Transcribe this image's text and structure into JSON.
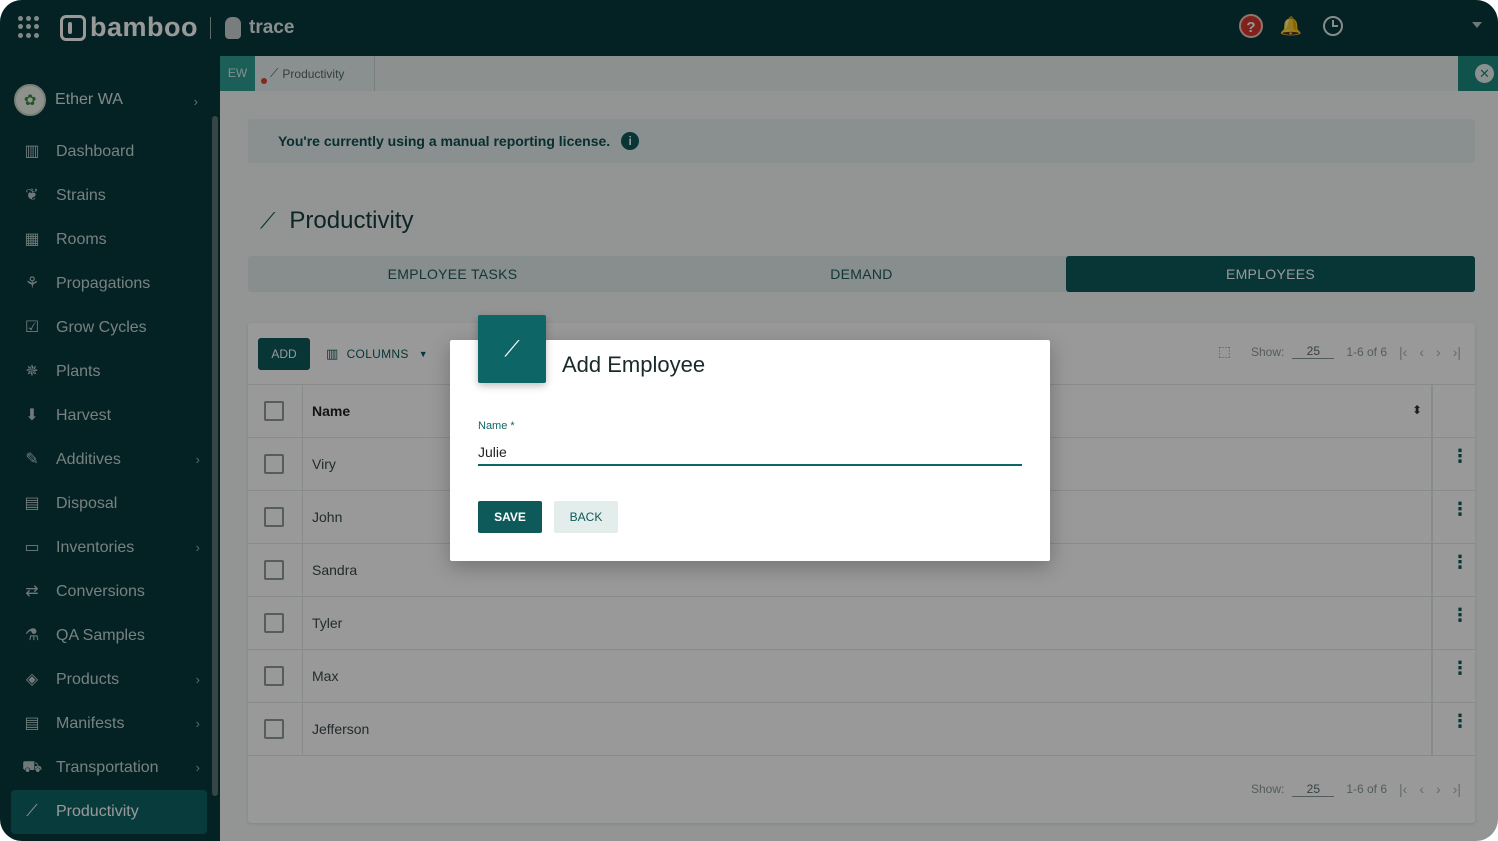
{
  "topbar": {
    "brand": "bamboo",
    "product": "trace",
    "help_glyph": "?"
  },
  "sidebar": {
    "org_name": "Ether WA",
    "items": [
      {
        "label": "Dashboard",
        "icon": "bar-chart-icon",
        "glyph": "▥",
        "has_children": false
      },
      {
        "label": "Strains",
        "icon": "leaf-bowl-icon",
        "glyph": "❦",
        "has_children": false
      },
      {
        "label": "Rooms",
        "icon": "rooms-grid-icon",
        "glyph": "▦",
        "has_children": false
      },
      {
        "label": "Propagations",
        "icon": "sprout-icon",
        "glyph": "⚘",
        "has_children": false
      },
      {
        "label": "Grow Cycles",
        "icon": "clipboard-check-icon",
        "glyph": "☑",
        "has_children": false
      },
      {
        "label": "Plants",
        "icon": "plant-icon",
        "glyph": "✵",
        "has_children": false
      },
      {
        "label": "Harvest",
        "icon": "harvest-tray-icon",
        "glyph": "⬇",
        "has_children": false
      },
      {
        "label": "Additives",
        "icon": "dropper-icon",
        "glyph": "✎",
        "has_children": true
      },
      {
        "label": "Disposal",
        "icon": "disposal-bin-icon",
        "glyph": "▤",
        "has_children": false
      },
      {
        "label": "Inventories",
        "icon": "inventory-box-icon",
        "glyph": "▭",
        "has_children": true
      },
      {
        "label": "Conversions",
        "icon": "swap-arrows-icon",
        "glyph": "⇄",
        "has_children": false
      },
      {
        "label": "QA Samples",
        "icon": "flask-icon",
        "glyph": "⚗",
        "has_children": false
      },
      {
        "label": "Products",
        "icon": "product-bag-icon",
        "glyph": "◈",
        "has_children": true
      },
      {
        "label": "Manifests",
        "icon": "document-icon",
        "glyph": "▤",
        "has_children": true
      },
      {
        "label": "Transportation",
        "icon": "truck-icon",
        "glyph": "⛟",
        "has_children": true
      },
      {
        "label": "Productivity",
        "icon": "trend-line-icon",
        "glyph": "⟋",
        "has_children": false,
        "active": true
      }
    ]
  },
  "tabstrip": {
    "badge": "EW",
    "open_tab": "Productivity"
  },
  "license_notice": "You're currently using a manual reporting license.",
  "page_title": "Productivity",
  "tabs": [
    {
      "label": "EMPLOYEE TASKS",
      "active": false
    },
    {
      "label": "DEMAND",
      "active": false
    },
    {
      "label": "EMPLOYEES",
      "active": true
    }
  ],
  "toolbar": {
    "add_label": "ADD",
    "columns_label": "COLUMNS"
  },
  "pager": {
    "show_label": "Show:",
    "page_size": "25",
    "range": "1-6 of 6"
  },
  "table": {
    "column_name": "Name",
    "rows": [
      "Viry",
      "John",
      "Sandra",
      "Tyler",
      "Max",
      "Jefferson"
    ]
  },
  "modal": {
    "title": "Add Employee",
    "field_label": "Name *",
    "field_value": "Julie",
    "save_label": "SAVE",
    "back_label": "BACK"
  },
  "colors": {
    "primary": "#0e5a5b",
    "topbar": "#08393b",
    "accent_strip": "#1b8a80",
    "alert_red": "#d33a2c"
  }
}
